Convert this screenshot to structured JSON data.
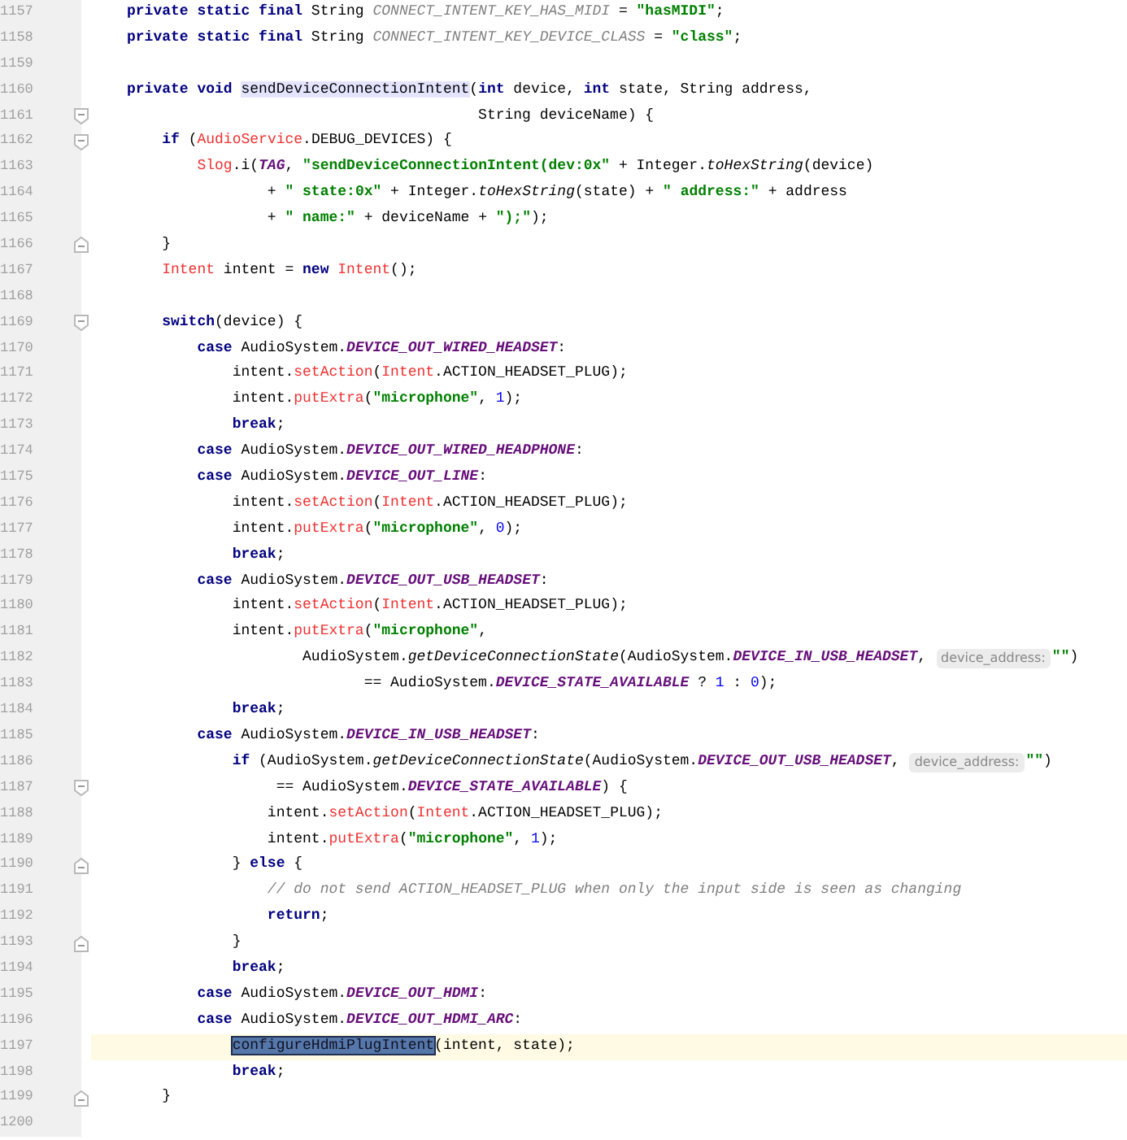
{
  "editor": {
    "lines": [
      {
        "number": "1157",
        "tokens": [
          {
            "text": "private static final",
            "kind": "keyword"
          },
          {
            "text": " String "
          },
          {
            "text": "CONNECT_INTENT_KEY_HAS_MIDI",
            "kind": "unused"
          },
          {
            "text": " = "
          },
          {
            "text": "\"hasMIDI\"",
            "kind": "string"
          },
          {
            "text": ";"
          }
        ]
      },
      {
        "number": "1158",
        "tokens": [
          {
            "text": "private static final",
            "kind": "keyword"
          },
          {
            "text": " String "
          },
          {
            "text": "CONNECT_INTENT_KEY_DEVICE_CLASS",
            "kind": "unused"
          },
          {
            "text": " = "
          },
          {
            "text": "\"class\"",
            "kind": "string"
          },
          {
            "text": ";"
          }
        ]
      },
      {
        "number": "1159"
      },
      {
        "number": "1160",
        "tokens": [
          {
            "text": "private void",
            "kind": "keyword"
          },
          {
            "text": " sendDeviceConnectionIntent",
            "kind": "usage"
          },
          {
            "text": "("
          },
          {
            "text": "int",
            "kind": "keyword"
          },
          {
            "text": " device, "
          },
          {
            "text": "int",
            "kind": "keyword"
          },
          {
            "text": " state, String address,"
          }
        ]
      },
      {
        "number": "1161",
        "fold_marker": {
          "kind": "start"
        },
        "tokens": [
          {
            "text": "                                        String deviceName) {"
          }
        ]
      },
      {
        "number": "1162",
        "fold_marker": {
          "kind": "start"
        },
        "tokens": [
          {
            "text": "    if",
            "kind": "keyword"
          },
          {
            "text": " ("
          },
          {
            "text": "AudioService",
            "kind": "error"
          },
          {
            "text": ".DEBUG_DEVICES) {"
          }
        ]
      },
      {
        "number": "1163",
        "tokens": [
          {
            "text": "        Slog",
            "kind": "error"
          },
          {
            "text": ".i("
          },
          {
            "text": "TAG",
            "kind": "constant"
          },
          {
            "text": ", "
          },
          {
            "text": "\"sendDeviceConnectionIntent(dev:0x\"",
            "kind": "string"
          },
          {
            "text": " + Integer."
          },
          {
            "text": "toHexString",
            "kind": "static"
          },
          {
            "text": "(device)"
          }
        ]
      },
      {
        "number": "1164",
        "tokens": [
          {
            "text": "                + "
          },
          {
            "text": "\" state:0x\"",
            "kind": "string"
          },
          {
            "text": " + Integer."
          },
          {
            "text": "toHexString",
            "kind": "static"
          },
          {
            "text": "(state) + "
          },
          {
            "text": "\" address:\"",
            "kind": "string"
          },
          {
            "text": " + address"
          }
        ]
      },
      {
        "number": "1165",
        "tokens": [
          {
            "text": "                + "
          },
          {
            "text": "\" name:\"",
            "kind": "string"
          },
          {
            "text": " + deviceName + "
          },
          {
            "text": "\");\"",
            "kind": "string"
          },
          {
            "text": ");"
          }
        ]
      },
      {
        "number": "1166",
        "fold_marker": {
          "kind": "end"
        },
        "tokens": [
          {
            "text": "    }"
          }
        ]
      },
      {
        "number": "1167",
        "tokens": [
          {
            "text": "    Intent",
            "kind": "error"
          },
          {
            "text": " intent = "
          },
          {
            "text": "new",
            "kind": "keyword"
          },
          {
            "text": " Intent",
            "kind": "error"
          },
          {
            "text": "();"
          }
        ]
      },
      {
        "number": "1168"
      },
      {
        "number": "1169",
        "fold_marker": {
          "kind": "start"
        },
        "tokens": [
          {
            "text": "    switch",
            "kind": "keyword"
          },
          {
            "text": "(device) {"
          }
        ]
      },
      {
        "number": "1170",
        "tokens": [
          {
            "text": "        case",
            "kind": "keyword"
          },
          {
            "text": " AudioSystem."
          },
          {
            "text": "DEVICE_OUT_WIRED_HEADSET",
            "kind": "constant"
          },
          {
            "text": ":"
          }
        ]
      },
      {
        "number": "1171",
        "tokens": [
          {
            "text": "            intent."
          },
          {
            "text": "setAction",
            "kind": "error"
          },
          {
            "text": "("
          },
          {
            "text": "Intent",
            "kind": "error"
          },
          {
            "text": ".ACTION_HEADSET_PLUG);"
          }
        ]
      },
      {
        "number": "1172",
        "tokens": [
          {
            "text": "            intent."
          },
          {
            "text": "putExtra",
            "kind": "error"
          },
          {
            "text": "("
          },
          {
            "text": "\"microphone\"",
            "kind": "string"
          },
          {
            "text": ", "
          },
          {
            "text": "1",
            "kind": "number"
          },
          {
            "text": ");"
          }
        ]
      },
      {
        "number": "1173",
        "tokens": [
          {
            "text": "            break",
            "kind": "keyword"
          },
          {
            "text": ";"
          }
        ]
      },
      {
        "number": "1174",
        "tokens": [
          {
            "text": "        case",
            "kind": "keyword"
          },
          {
            "text": " AudioSystem."
          },
          {
            "text": "DEVICE_OUT_WIRED_HEADPHONE",
            "kind": "constant"
          },
          {
            "text": ":"
          }
        ]
      },
      {
        "number": "1175",
        "tokens": [
          {
            "text": "        case",
            "kind": "keyword"
          },
          {
            "text": " AudioSystem."
          },
          {
            "text": "DEVICE_OUT_LINE",
            "kind": "constant"
          },
          {
            "text": ":"
          }
        ]
      },
      {
        "number": "1176",
        "tokens": [
          {
            "text": "            intent."
          },
          {
            "text": "setAction",
            "kind": "error"
          },
          {
            "text": "("
          },
          {
            "text": "Intent",
            "kind": "error"
          },
          {
            "text": ".ACTION_HEADSET_PLUG);"
          }
        ]
      },
      {
        "number": "1177",
        "tokens": [
          {
            "text": "            intent."
          },
          {
            "text": "putExtra",
            "kind": "error"
          },
          {
            "text": "("
          },
          {
            "text": "\"microphone\"",
            "kind": "string"
          },
          {
            "text": ", "
          },
          {
            "text": "0",
            "kind": "number"
          },
          {
            "text": ");"
          }
        ]
      },
      {
        "number": "1178",
        "tokens": [
          {
            "text": "            break",
            "kind": "keyword"
          },
          {
            "text": ";"
          }
        ]
      },
      {
        "number": "1179",
        "tokens": [
          {
            "text": "        case",
            "kind": "keyword"
          },
          {
            "text": " AudioSystem."
          },
          {
            "text": "DEVICE_OUT_USB_HEADSET",
            "kind": "constant"
          },
          {
            "text": ":"
          }
        ]
      },
      {
        "number": "1180",
        "tokens": [
          {
            "text": "            intent."
          },
          {
            "text": "setAction",
            "kind": "error"
          },
          {
            "text": "("
          },
          {
            "text": "Intent",
            "kind": "error"
          },
          {
            "text": ".ACTION_HEADSET_PLUG);"
          }
        ]
      },
      {
        "number": "1181",
        "tokens": [
          {
            "text": "            intent."
          },
          {
            "text": "putExtra",
            "kind": "error"
          },
          {
            "text": "("
          },
          {
            "text": "\"microphone\"",
            "kind": "string"
          },
          {
            "text": ","
          }
        ]
      },
      {
        "number": "1182",
        "tokens": [
          {
            "text": "                    AudioSystem."
          },
          {
            "text": "getDeviceConnectionState",
            "kind": "static"
          },
          {
            "text": "(AudioSystem."
          },
          {
            "text": "DEVICE_IN_USB_HEADSET",
            "kind": "constant"
          },
          {
            "text": ","
          },
          {
            "text": "device_address:",
            "kind": "hint"
          },
          {
            "text": "\"\"",
            "kind": "string"
          },
          {
            "text": ")"
          }
        ]
      },
      {
        "number": "1183",
        "tokens": [
          {
            "text": "                           == AudioSystem."
          },
          {
            "text": "DEVICE_STATE_AVAILABLE",
            "kind": "constant"
          },
          {
            "text": " ? "
          },
          {
            "text": "1",
            "kind": "number"
          },
          {
            "text": " : "
          },
          {
            "text": "0",
            "kind": "number"
          },
          {
            "text": ");"
          }
        ]
      },
      {
        "number": "1184",
        "tokens": [
          {
            "text": "            break",
            "kind": "keyword"
          },
          {
            "text": ";"
          }
        ]
      },
      {
        "number": "1185",
        "tokens": [
          {
            "text": "        case",
            "kind": "keyword"
          },
          {
            "text": " AudioSystem."
          },
          {
            "text": "DEVICE_IN_USB_HEADSET",
            "kind": "constant"
          },
          {
            "text": ":"
          }
        ]
      },
      {
        "number": "1186",
        "tokens": [
          {
            "text": "            if",
            "kind": "keyword"
          },
          {
            "text": " (AudioSystem."
          },
          {
            "text": "getDeviceConnectionState",
            "kind": "static"
          },
          {
            "text": "(AudioSystem."
          },
          {
            "text": "DEVICE_OUT_USB_HEADSET",
            "kind": "constant"
          },
          {
            "text": ","
          },
          {
            "text": "device_address:",
            "kind": "hint"
          },
          {
            "text": "\"\"",
            "kind": "string"
          },
          {
            "text": ")"
          }
        ]
      },
      {
        "number": "1187",
        "fold_marker": {
          "kind": "start"
        },
        "tokens": [
          {
            "text": "                 == AudioSystem."
          },
          {
            "text": "DEVICE_STATE_AVAILABLE",
            "kind": "constant"
          },
          {
            "text": ") {"
          }
        ]
      },
      {
        "number": "1188",
        "tokens": [
          {
            "text": "                intent."
          },
          {
            "text": "setAction",
            "kind": "error"
          },
          {
            "text": "("
          },
          {
            "text": "Intent",
            "kind": "error"
          },
          {
            "text": ".ACTION_HEADSET_PLUG);"
          }
        ]
      },
      {
        "number": "1189",
        "tokens": [
          {
            "text": "                intent."
          },
          {
            "text": "putExtra",
            "kind": "error"
          },
          {
            "text": "("
          },
          {
            "text": "\"microphone\"",
            "kind": "string"
          },
          {
            "text": ", "
          },
          {
            "text": "1",
            "kind": "number"
          },
          {
            "text": ");"
          }
        ]
      },
      {
        "number": "1190",
        "fold_marker": {
          "kind": "end"
        },
        "tokens": [
          {
            "text": "            }"
          },
          {
            "text": " else",
            "kind": "keyword"
          },
          {
            "text": " {"
          }
        ]
      },
      {
        "number": "1191",
        "tokens": [
          {
            "text": "                // do not send ACTION_HEADSET_PLUG when only the input side is seen as changing",
            "kind": "comment"
          }
        ]
      },
      {
        "number": "1192",
        "tokens": [
          {
            "text": "                return",
            "kind": "keyword"
          },
          {
            "text": ";"
          }
        ]
      },
      {
        "number": "1193",
        "fold_marker": {
          "kind": "end"
        },
        "tokens": [
          {
            "text": "            }"
          }
        ]
      },
      {
        "number": "1194",
        "tokens": [
          {
            "text": "            break",
            "kind": "keyword"
          },
          {
            "text": ";"
          }
        ]
      },
      {
        "number": "1195",
        "tokens": [
          {
            "text": "        case",
            "kind": "keyword"
          },
          {
            "text": " AudioSystem."
          },
          {
            "text": "DEVICE_OUT_HDMI",
            "kind": "constant"
          },
          {
            "text": ":"
          }
        ]
      },
      {
        "number": "1196",
        "tokens": [
          {
            "text": "        case",
            "kind": "keyword"
          },
          {
            "text": " AudioSystem."
          },
          {
            "text": "DEVICE_OUT_HDMI_ARC",
            "kind": "constant"
          },
          {
            "text": ":"
          }
        ]
      },
      {
        "number": "1197",
        "current": true,
        "tokens": [
          {
            "text": "            configureHdmiPlugIntent",
            "kind": "selected"
          },
          {
            "text": "(intent, state);"
          }
        ]
      },
      {
        "number": "1198",
        "tokens": [
          {
            "text": "            break",
            "kind": "keyword"
          },
          {
            "text": ";"
          }
        ]
      },
      {
        "number": "1199",
        "fold_marker": {
          "kind": "end"
        },
        "tokens": [
          {
            "text": "    }"
          }
        ]
      },
      {
        "number": "1200"
      }
    ]
  }
}
